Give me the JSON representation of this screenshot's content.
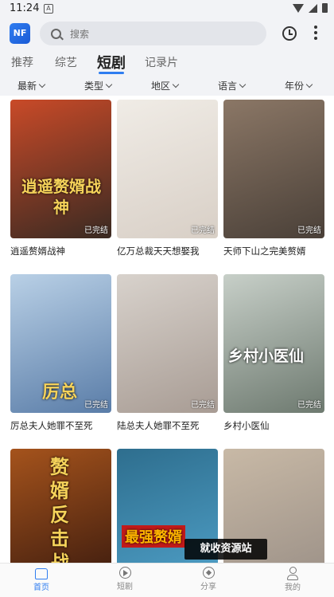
{
  "status_bar": {
    "time": "11:24",
    "notification_icon": "A"
  },
  "header": {
    "logo_text": "NF",
    "search_placeholder": "搜索"
  },
  "tabs": [
    {
      "label": "推荐",
      "active": false
    },
    {
      "label": "综艺",
      "active": false
    },
    {
      "label": "短剧",
      "active": true
    },
    {
      "label": "记录片",
      "active": false
    }
  ],
  "filters": [
    {
      "label": "最新"
    },
    {
      "label": "类型"
    },
    {
      "label": "地区"
    },
    {
      "label": "语言"
    },
    {
      "label": "年份"
    }
  ],
  "cards": [
    {
      "title": "逍遥赘婿战神",
      "badge": "已完结",
      "poster_text": "逍遥赘婿战神",
      "bg": "#3a2a22",
      "accent": "#c94a28"
    },
    {
      "title": "亿万总裁天天想娶我",
      "badge": "已完结",
      "poster_text": "",
      "bg": "#d8cfc6",
      "accent": "#f0ece6"
    },
    {
      "title": "天师下山之完美赘婿",
      "badge": "已完结",
      "poster_text": "",
      "bg": "#4a4038",
      "accent": "#8b7766"
    },
    {
      "title": "厉总夫人她罪不至死",
      "badge": "已完结",
      "poster_text": "厉总",
      "bg": "#5a7da8",
      "accent": "#b9d0e6"
    },
    {
      "title": "陆总夫人她罪不至死",
      "badge": "已完结",
      "poster_text": "",
      "bg": "#a89c94",
      "accent": "#d8d2cc"
    },
    {
      "title": "乡村小医仙",
      "badge": "已完结",
      "poster_text": "乡村小医仙",
      "bg": "#6e7a70",
      "accent": "#c7cfc8"
    },
    {
      "title": "",
      "badge": "",
      "poster_text": "赘婿反击战",
      "bg": "#3a1a0e",
      "accent": "#a5531c"
    },
    {
      "title": "",
      "badge": "",
      "poster_text": "最强赘婿",
      "bg": "#4fa0c8",
      "accent": "#2e6e8e"
    },
    {
      "title": "",
      "badge": "",
      "poster_text": "",
      "bg": "#9a8f86",
      "accent": "#c8b9a6"
    }
  ],
  "watermark": "就收资源站",
  "bottom_nav": [
    {
      "label": "首页",
      "icon": "home-icon",
      "active": true
    },
    {
      "label": "短剧",
      "icon": "play-circle-icon",
      "active": false
    },
    {
      "label": "分享",
      "icon": "compass-icon",
      "active": false
    },
    {
      "label": "我的",
      "icon": "user-icon",
      "active": false
    }
  ],
  "colors": {
    "accent": "#2f7df0",
    "header_bg": "#f2f3f6"
  }
}
